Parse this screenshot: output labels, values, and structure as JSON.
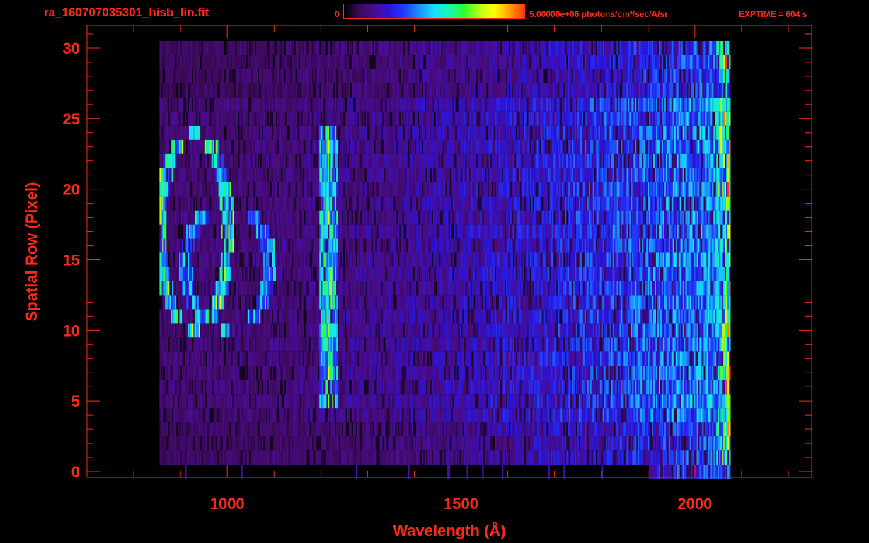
{
  "header": {
    "title": "ra_160707035301_hisb_lin.fit",
    "colorbar_min": "0",
    "colorbar_max_label": "5.00000e+06 photons/cm²/sec/A/sr",
    "exptime": "EXPTIME = 604 s"
  },
  "colors": {
    "foreground": "#ff2a1a",
    "background": "#000000",
    "colormap": [
      "#000000",
      "#3a0a55",
      "#4b0c8c",
      "#2a14d8",
      "#1f3cff",
      "#1e90ff",
      "#16e0ff",
      "#17f7b0",
      "#2dff2d",
      "#b4ff18",
      "#ffff00",
      "#ffa000",
      "#ff3a14"
    ]
  },
  "chart_data": {
    "type": "heatmap",
    "title": "ra_160707035301_hisb_lin.fit",
    "xlabel": "Wavelength (Å)",
    "ylabel": "Spatial Row (Pixel)",
    "xlim": [
      700,
      2250
    ],
    "ylim": [
      -0.4,
      31.6
    ],
    "xticks": [
      1000,
      1500,
      2000
    ],
    "xtick_labels": [
      "1000",
      "1500",
      "2000"
    ],
    "yticks": [
      0,
      5,
      10,
      15,
      20,
      25,
      30
    ],
    "ytick_labels": [
      "0",
      "5",
      "10",
      "15",
      "20",
      "25",
      "30"
    ],
    "x_minor_step": 100,
    "y_minor_step": 1,
    "color_scale": {
      "min": 0,
      "max": 5000000,
      "units": "photons/cm²/sec/A/sr",
      "scale": "linear"
    },
    "data_extent": {
      "x": [
        855,
        2075
      ],
      "rows": [
        0,
        30
      ]
    },
    "features": [
      {
        "type": "vertical_line",
        "x": 1216,
        "rows": [
          5,
          24
        ],
        "intensity": 0.62
      },
      {
        "type": "horizontal_band",
        "row": 15.5,
        "x": [
          1000,
          2040
        ],
        "intensity": 0.45
      },
      {
        "type": "horizontal_band",
        "row": 14.5,
        "x": [
          1000,
          2040
        ],
        "intensity": 0.38
      },
      {
        "type": "horizontal_band",
        "row": 8.5,
        "x": [
          1100,
          1700
        ],
        "intensity": 0.33
      },
      {
        "type": "arc",
        "rows": [
          10,
          24
        ],
        "x": [
          855,
          1000
        ],
        "intensity": 0.6
      },
      {
        "type": "arc",
        "rows": [
          10,
          19
        ],
        "x": [
          900,
          1100
        ],
        "intensity": 0.45
      },
      {
        "type": "edge",
        "x": 2060,
        "rows": [
          1,
          30
        ],
        "intensity": 0.7
      }
    ]
  }
}
